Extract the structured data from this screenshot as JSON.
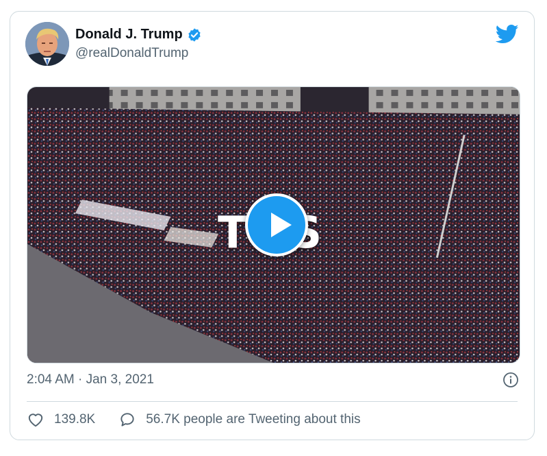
{
  "tweet": {
    "author_name": "Donald J. Trump",
    "handle": "@realDonaldTrump",
    "timestamp": "2:04 AM · Jan 3, 2021",
    "likes": "139.8K",
    "replies_text": "56.7K people are Tweeting about this"
  },
  "media": {
    "overlay_text": "TOS",
    "type": "video"
  },
  "colors": {
    "brand": "#1d9bf0",
    "verified": "#1d9bf0",
    "secondary_text": "#536471",
    "border": "#cfd9de"
  },
  "icons": {
    "verified": "verified-badge-icon",
    "logo": "twitter-bird-icon",
    "play": "play-icon",
    "info": "info-icon",
    "like": "heart-icon",
    "reply": "speech-bubble-icon"
  }
}
